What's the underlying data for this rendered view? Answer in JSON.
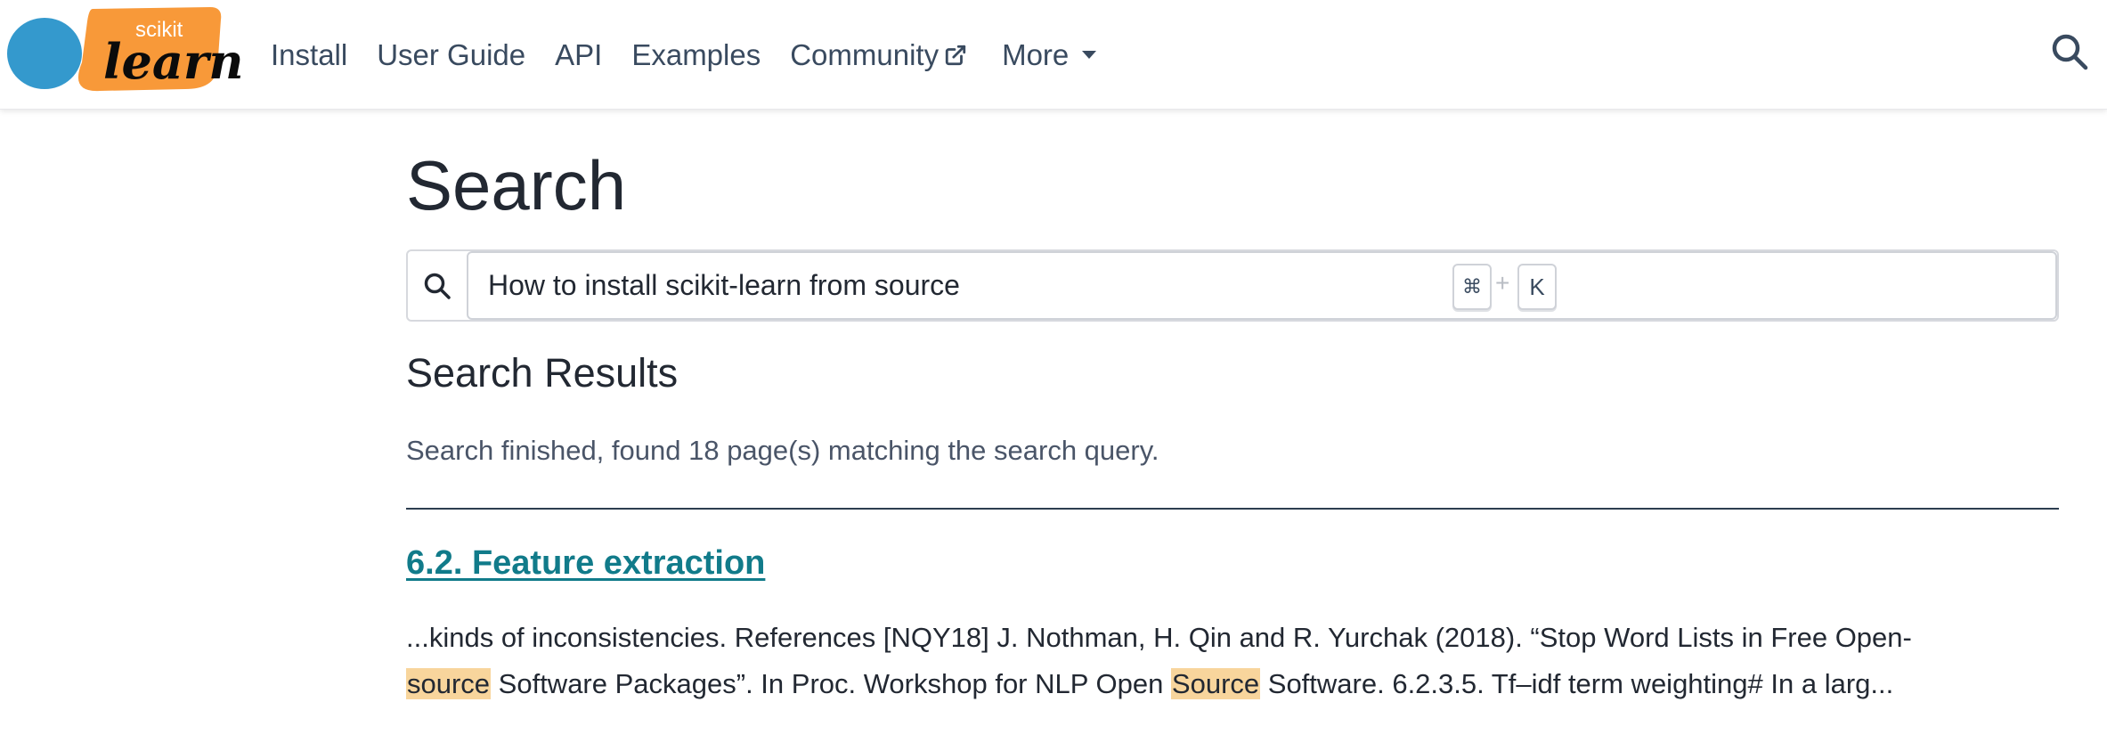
{
  "header": {
    "logo_top_text": "scikit",
    "logo_bottom_text": "learn",
    "nav": [
      {
        "label": "Install"
      },
      {
        "label": "User Guide"
      },
      {
        "label": "API"
      },
      {
        "label": "Examples"
      },
      {
        "label": "Community"
      },
      {
        "label": "More"
      }
    ],
    "icons": {
      "community_external": "external-link-icon",
      "more_caret": "caret-down-icon",
      "search": "search-icon"
    }
  },
  "main": {
    "title": "Search",
    "search": {
      "value": "How to install scikit-learn from source",
      "shortcut_key_1": "⌘",
      "shortcut_plus": "+",
      "shortcut_key_2": "K"
    },
    "results_heading": "Search Results",
    "status": "Search finished, found 18 page(s) matching the search query.",
    "results": [
      {
        "title": "6.2. Feature extraction",
        "snippet_parts": [
          "...kinds of inconsistencies. References [NQY18] J. Nothman, H. Qin and R. Yurchak (2018). “Stop Word Lists in Free Open-",
          "source",
          " Software Packages”. In Proc. Workshop for NLP Open ",
          "Source",
          " Software. 6.2.3.5. Tf–idf term weighting# In a larg..."
        ]
      }
    ]
  },
  "colors": {
    "link": "#117b8a",
    "nav_text": "#394a5f",
    "highlight": "#f8d59c",
    "logo_blue": "#3499cd",
    "logo_orange": "#f89939"
  }
}
